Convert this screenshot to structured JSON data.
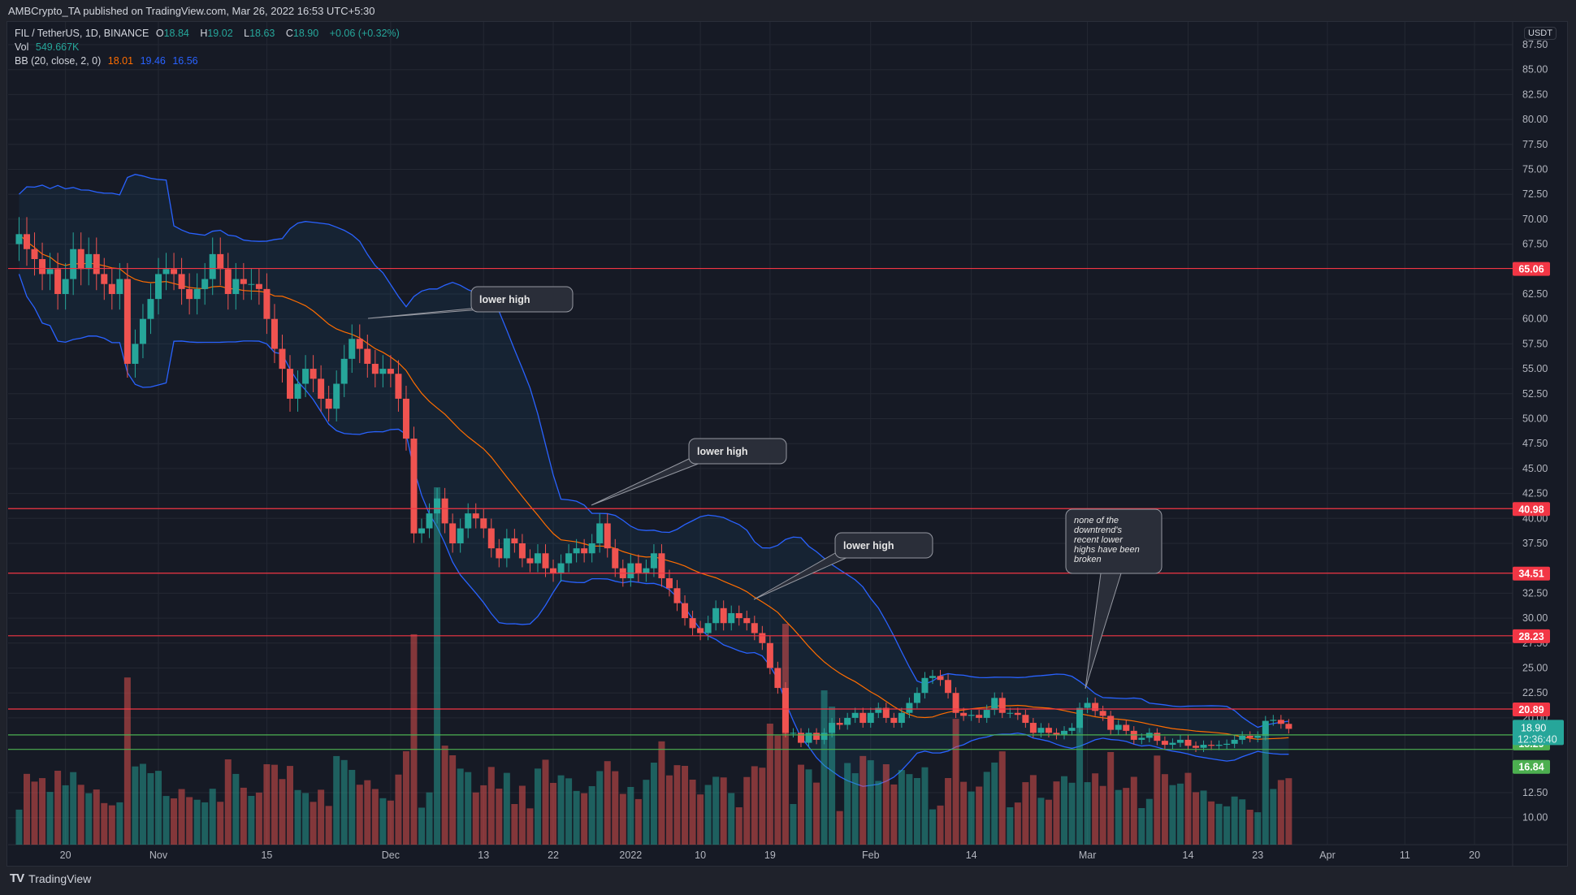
{
  "header": {
    "published": "AMBCrypto_TA published on TradingView.com, Mar 26, 2022 16:53 UTC+5:30"
  },
  "legend": {
    "symbol": "FIL / TetherUS, 1D, BINANCE",
    "open_label": "O",
    "open": "18.84",
    "high_label": "H",
    "high": "19.02",
    "low_label": "L",
    "low": "18.63",
    "close_label": "C",
    "close": "18.90",
    "change": "+0.06 (+0.32%)",
    "vol_label": "Vol",
    "vol": "549.667K",
    "bb_label": "BB (20, close, 2, 0)",
    "bb_basis": "18.01",
    "bb_upper": "19.46",
    "bb_lower": "16.56"
  },
  "currency": "USDT",
  "footer": {
    "logo": "TV",
    "brand": "TradingView"
  },
  "colors": {
    "up": "#26a69a",
    "down": "#ef5350",
    "basis": "#ff6d00",
    "band": "#2962ff",
    "resistance": "#f23645",
    "support": "#4caf50"
  },
  "chart_data": {
    "type": "candlestick",
    "title": "FIL / TetherUS, 1D, BINANCE",
    "ylabel": "USDT",
    "ylim": [
      6.0,
      89.5
    ],
    "y_ticks": [
      "87.50",
      "85.00",
      "82.50",
      "80.00",
      "77.50",
      "75.00",
      "72.50",
      "70.00",
      "67.50",
      "62.50",
      "60.00",
      "57.50",
      "55.00",
      "52.50",
      "50.00",
      "47.50",
      "45.00",
      "42.50",
      "40.00",
      "37.50",
      "32.50",
      "30.00",
      "27.50",
      "25.00",
      "22.50",
      "20.00",
      "12.50",
      "10.00"
    ],
    "x_ticks": [
      {
        "label": "20",
        "day": -12
      },
      {
        "label": "Nov",
        "day": 0
      },
      {
        "label": "15",
        "day": 14
      },
      {
        "label": "Dec",
        "day": 30
      },
      {
        "label": "13",
        "day": 42
      },
      {
        "label": "22",
        "day": 51
      },
      {
        "label": "2022",
        "day": 61
      },
      {
        "label": "10",
        "day": 70
      },
      {
        "label": "19",
        "day": 79
      },
      {
        "label": "Feb",
        "day": 92
      },
      {
        "label": "14",
        "day": 105
      },
      {
        "label": "Mar",
        "day": 120
      },
      {
        "label": "14",
        "day": 133
      },
      {
        "label": "23",
        "day": 142
      },
      {
        "label": "Apr",
        "day": 151
      },
      {
        "label": "11",
        "day": 161
      },
      {
        "label": "20",
        "day": 170
      }
    ],
    "horizontal_levels": [
      {
        "value": 65.06,
        "label": "65.06",
        "kind": "resistance"
      },
      {
        "value": 40.98,
        "label": "40.98",
        "kind": "resistance"
      },
      {
        "value": 34.51,
        "label": "34.51",
        "kind": "resistance"
      },
      {
        "value": 28.23,
        "label": "28.23",
        "kind": "resistance"
      },
      {
        "value": 20.89,
        "label": "20.89",
        "kind": "resistance"
      },
      {
        "value": 18.29,
        "label": "18.29",
        "kind": "support"
      },
      {
        "value": 16.84,
        "label": "16.84",
        "kind": "support"
      }
    ],
    "last_price": {
      "value": 18.9,
      "label": "18.90",
      "countdown": "12:36:40"
    },
    "closes": [
      68.5,
      67.0,
      66.0,
      64.5,
      65.0,
      62.5,
      64.0,
      67.0,
      65.0,
      66.5,
      64.5,
      63.5,
      62.5,
      64.0,
      55.5,
      57.5,
      60.0,
      62.0,
      64.5,
      65.0,
      64.5,
      63.0,
      62.0,
      63.0,
      64.0,
      66.5,
      65.0,
      62.5,
      64.0,
      63.5,
      63.5,
      63.0,
      60.0,
      57.0,
      55.0,
      52.0,
      53.5,
      55.0,
      54.0,
      52.0,
      51.0,
      53.5,
      56.0,
      58.0,
      57.0,
      55.5,
      54.5,
      55.0,
      54.5,
      52.0,
      48.0,
      38.5,
      39.0,
      40.5,
      42.0,
      39.5,
      37.5,
      39.0,
      40.5,
      40.0,
      39.0,
      37.0,
      36.0,
      38.0,
      37.5,
      36.0,
      35.5,
      36.5,
      35.0,
      34.5,
      35.5,
      36.5,
      37.0,
      36.5,
      37.5,
      39.5,
      37.0,
      35.0,
      34.0,
      35.5,
      34.5,
      35.0,
      36.5,
      34.0,
      33.0,
      31.5,
      30.0,
      29.0,
      28.5,
      29.5,
      31.0,
      29.5,
      30.5,
      30.0,
      29.5,
      28.5,
      27.5,
      25.0,
      23.0,
      18.5,
      18.5,
      17.5,
      18.5,
      17.8,
      18.5,
      19.5,
      19.3,
      20.0,
      20.5,
      19.5,
      20.5,
      21.0,
      20.0,
      19.5,
      20.5,
      21.5,
      22.5,
      24.0,
      24.2,
      23.8,
      22.5,
      20.5,
      20.2,
      20.3,
      20.0,
      20.8,
      22.0,
      20.5,
      20.5,
      20.3,
      19.5,
      18.5,
      19.0,
      18.5,
      18.3,
      18.7,
      19.0,
      21.0,
      21.5,
      20.7,
      20.2,
      18.8,
      19.3,
      18.7,
      17.8,
      18.0,
      18.5,
      17.7,
      17.3,
      17.5,
      17.8,
      17.2,
      17.0,
      17.3,
      17.2,
      17.3,
      17.4,
      17.8,
      18.2,
      18.0,
      18.2,
      19.7,
      19.8,
      19.4,
      18.9
    ],
    "volume_unit": "relative",
    "annotations": [
      {
        "text": "lower high"
      },
      {
        "text": "lower high"
      },
      {
        "text": "lower high"
      },
      {
        "text": "none of the downtrend's recent lower highs have been broken"
      }
    ]
  }
}
